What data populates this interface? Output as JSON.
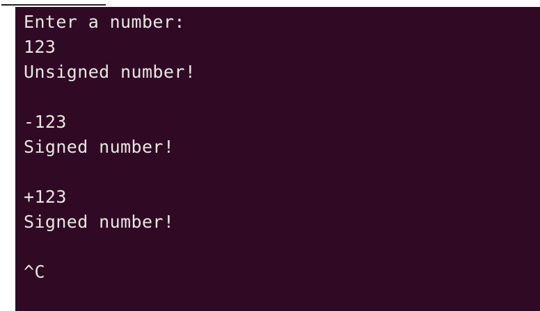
{
  "terminal": {
    "lines": [
      "Enter a number:",
      "123",
      "Unsigned number!",
      "",
      "-123",
      "Signed number!",
      "",
      "+123",
      "Signed number!",
      "",
      "^C"
    ]
  },
  "colors": {
    "terminal_background": "#300a24",
    "terminal_text": "#e8e6e3"
  }
}
